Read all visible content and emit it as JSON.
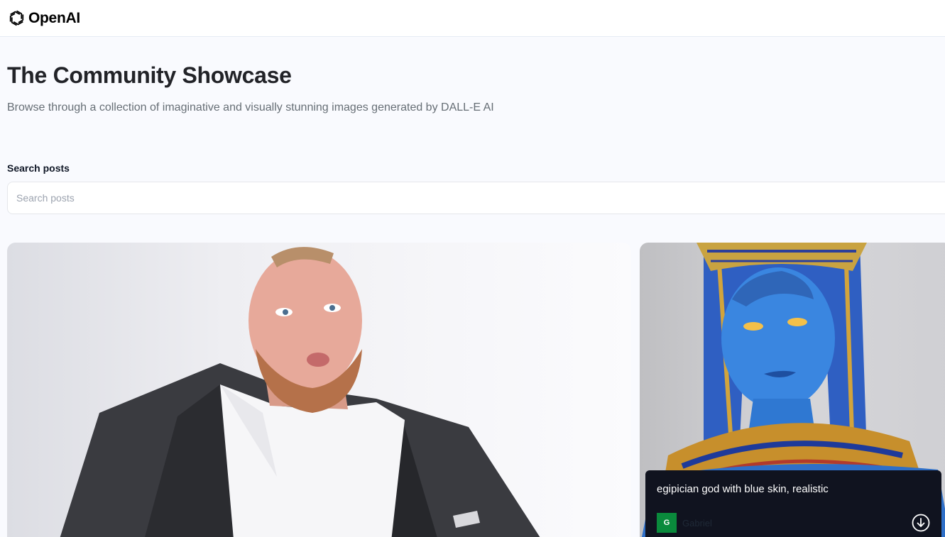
{
  "header": {
    "logo_text": "OpenAI",
    "logo_icon": "openai-knot-icon"
  },
  "hero": {
    "title": "The Community Showcase",
    "subtitle": "Browse through a collection of imaginative and visually stunning images generated by DALL-E AI"
  },
  "search": {
    "label": "Search posts",
    "placeholder": "Search posts",
    "value": ""
  },
  "posts": [
    {
      "image": "man-in-suit-portrait"
    },
    {
      "image": "blue-egyptian-god-portrait",
      "prompt": "egipician god with blue skin, realistic",
      "author": "Gabriel",
      "author_initial": "G",
      "download_icon": "download-icon"
    }
  ],
  "colors": {
    "avatar": "#0a8a3c",
    "overlay": "#10131f",
    "background": "#f9fafe"
  }
}
